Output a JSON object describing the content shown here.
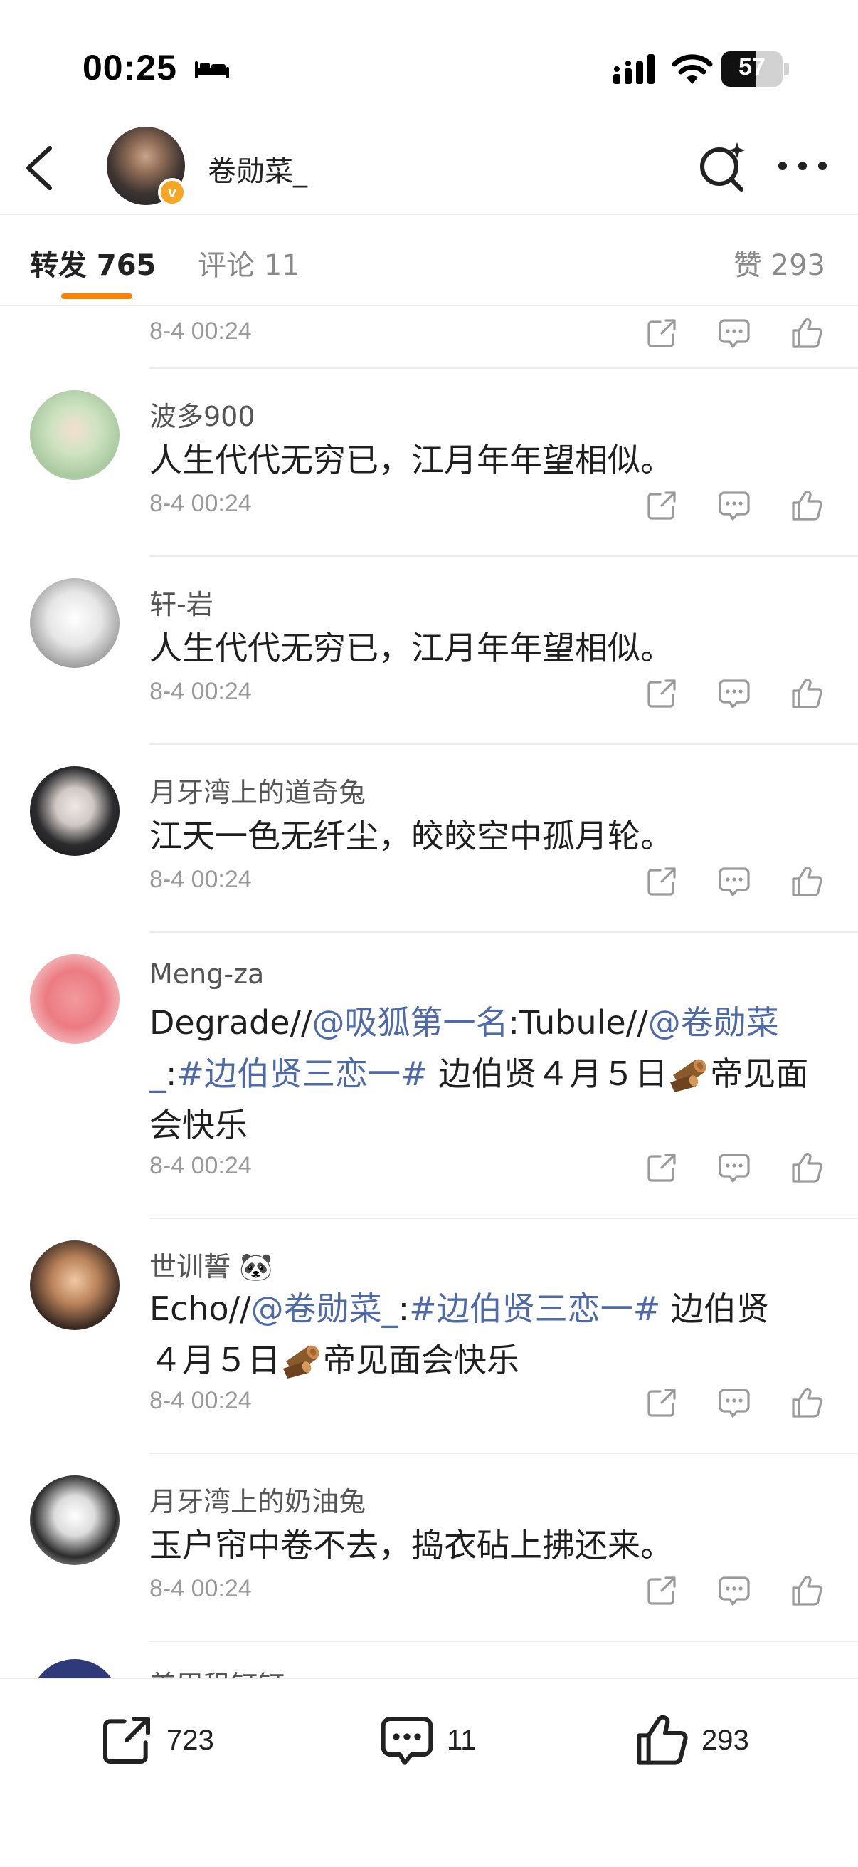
{
  "status_bar": {
    "time": "00:25",
    "battery": "57",
    "battery_level": 0.57
  },
  "header": {
    "username": "卷勋菜_",
    "verified_badge": "v"
  },
  "tabs": {
    "repost_label": "转发 765",
    "comment_label": "评论 11",
    "like_label": "赞 293"
  },
  "top_item": {
    "timestamp": "8-4 00:24"
  },
  "items": [
    {
      "username": "波多900",
      "text": "人生代代无穷已，江月年年望相似。",
      "timestamp": "8-4 00:24"
    },
    {
      "username": "轩-岩",
      "text": "人生代代无穷已，江月年年望相似。",
      "timestamp": "8-4 00:24"
    },
    {
      "username": "月牙湾上的道奇兔",
      "text": "江天一色无纤尘，皎皎空中孤月轮。",
      "timestamp": "8-4 00:24"
    },
    {
      "username": "Meng-za",
      "text_parts": [
        "Degrade//",
        "@吸狐第一名",
        ":Tubule//",
        "@卷勋菜",
        "_",
        ":",
        "#边伯贤三恋一#",
        " 边伯贤４月５日",
        "帝见面会快乐"
      ],
      "timestamp": "8-4 00:24"
    },
    {
      "username": "世训誓",
      "username_emoji": "🐼",
      "text_parts": [
        "Echo//",
        "@卷勋菜_",
        ":",
        "#边伯贤三恋一#",
        " 边伯贤",
        "４月５日",
        "帝见面会快乐"
      ],
      "timestamp": "8-4 00:24"
    },
    {
      "username": "月牙湾上的奶油兔",
      "text": "玉户帘中卷不去，捣衣砧上拂还来。",
      "timestamp": "8-4 00:24"
    }
  ],
  "partial_item": {
    "username": "美甲租钉钉"
  },
  "bottom_bar": {
    "repost_count": "723",
    "comment_count": "11",
    "like_count": "293"
  },
  "colors": {
    "accent": "#ff8200",
    "link": "#4f6aa8",
    "badge": "#f6a623"
  },
  "icons": [
    "bed-icon",
    "signal-icon",
    "wifi-icon",
    "battery-icon",
    "back-icon",
    "search-icon",
    "more-icon",
    "share-icon",
    "comment-icon",
    "like-icon",
    "log-emoji-icon"
  ]
}
